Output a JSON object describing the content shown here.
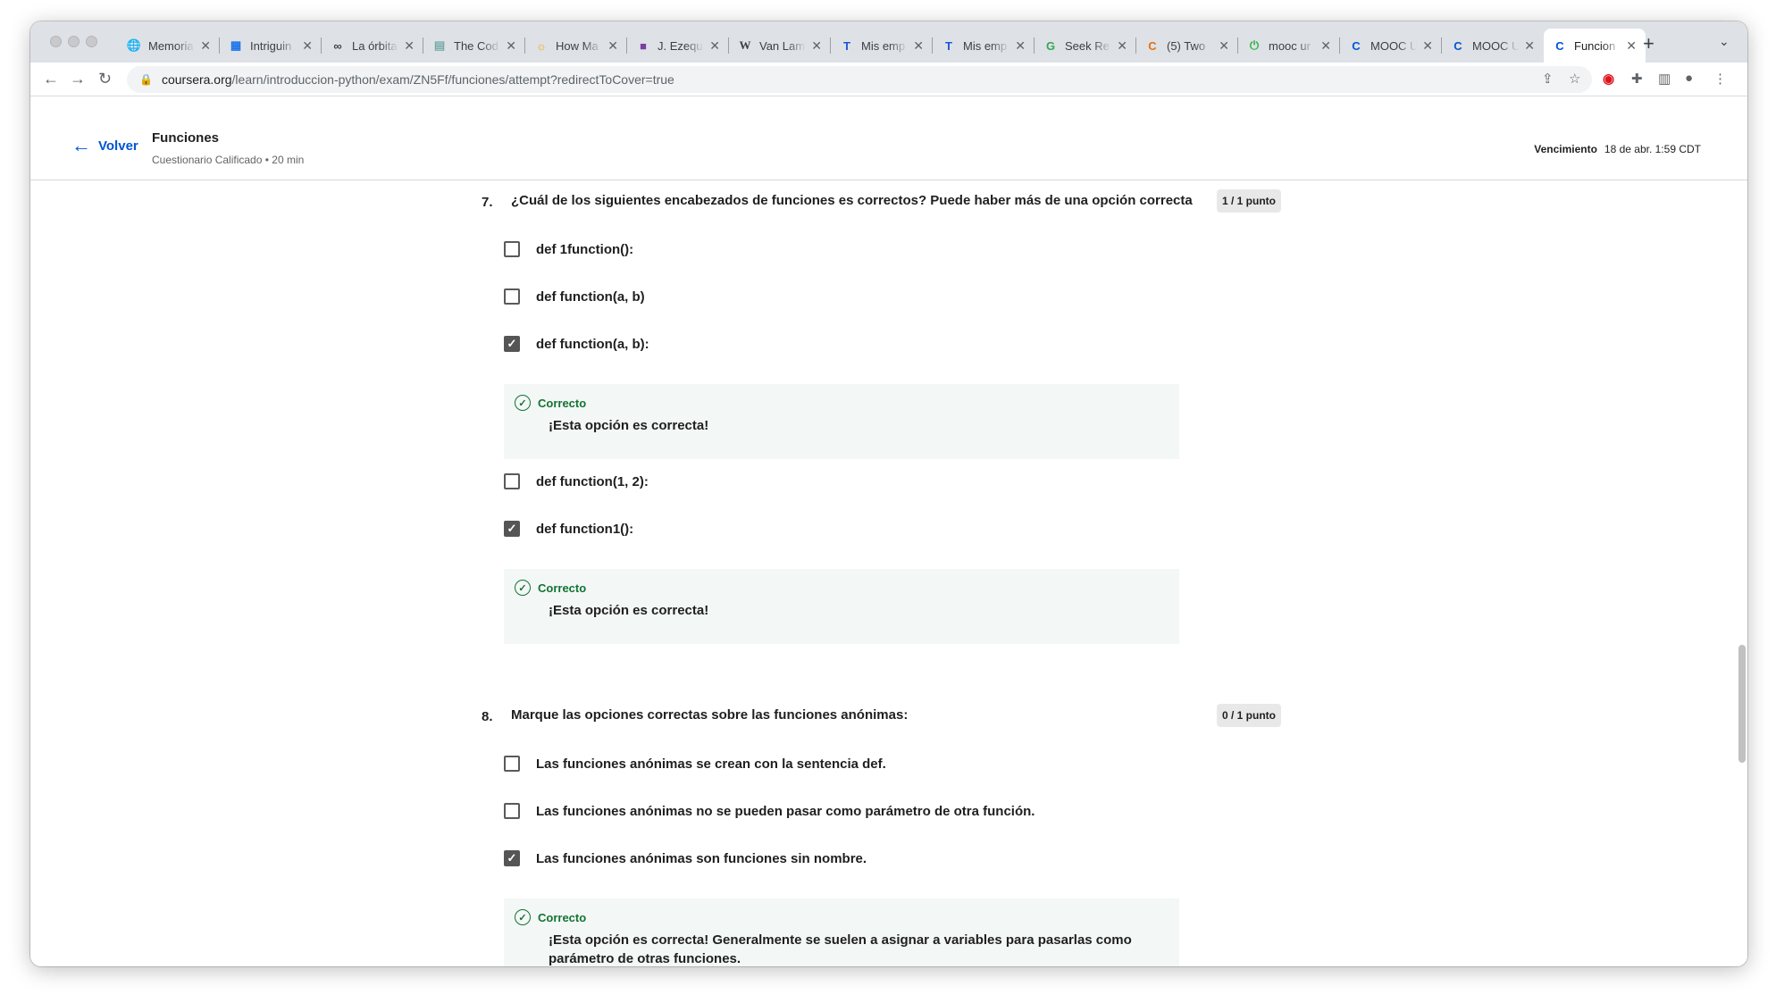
{
  "browser": {
    "tabs": [
      {
        "title": "Memoria",
        "icon": "globe-icon"
      },
      {
        "title": "Intriguin",
        "icon": "table-icon"
      },
      {
        "title": "La órbita",
        "icon": "infinity-icon"
      },
      {
        "title": "The Cod",
        "icon": "page-icon"
      },
      {
        "title": "How Ma",
        "icon": "sun-icon"
      },
      {
        "title": "J. Ezequ",
        "icon": "purple-square-icon"
      },
      {
        "title": "Van Lam",
        "icon": "wikipedia-icon"
      },
      {
        "title": "Mis emp",
        "icon": "blue-t-icon"
      },
      {
        "title": "Mis emp",
        "icon": "blue-t-icon"
      },
      {
        "title": "Seek Re",
        "icon": "google-icon"
      },
      {
        "title": "(5) Two",
        "icon": "colorful-c-icon"
      },
      {
        "title": "mooc ur",
        "icon": "green-power-icon"
      },
      {
        "title": "MOOC U",
        "icon": "coursera-icon"
      },
      {
        "title": "MOOC U",
        "icon": "coursera-icon"
      },
      {
        "title": "Funcion",
        "icon": "coursera-icon",
        "active": true
      }
    ],
    "url_host": "coursera.org",
    "url_path": "/learn/introduccion-python/exam/ZN5Ff/funciones/attempt?redirectToCover=true"
  },
  "header": {
    "back_label": "Volver",
    "title": "Funciones",
    "subtitle": "Cuestionario Calificado • 20 min",
    "due_label": "Vencimiento",
    "due_value": "18 de abr. 1:59 CDT"
  },
  "questions": [
    {
      "number": "7.",
      "text": "¿Cuál de los siguientes encabezados de funciones es correctos? Puede haber más de una opción correcta",
      "score": "1 / 1 punto",
      "options": [
        {
          "label": "def 1function():",
          "checked": false
        },
        {
          "label": "def function(a, b)",
          "checked": false
        },
        {
          "label": "def function(a, b):",
          "checked": true,
          "feedback_title": "Correcto",
          "feedback": "¡Esta opción es correcta!"
        },
        {
          "label": "def function(1, 2):",
          "checked": false
        },
        {
          "label": "def function1():",
          "checked": true,
          "feedback_title": "Correcto",
          "feedback": "¡Esta opción es correcta!"
        }
      ]
    },
    {
      "number": "8.",
      "text": "Marque las opciones correctas sobre las funciones anónimas:",
      "score": "0 / 1 punto",
      "options": [
        {
          "label": "Las funciones anónimas se crean con la sentencia def.",
          "checked": false
        },
        {
          "label": "Las funciones anónimas no se pueden pasar como parámetro de otra función.",
          "checked": false
        },
        {
          "label": "Las funciones anónimas son funciones sin nombre.",
          "checked": true,
          "feedback_title": "Correcto",
          "feedback": "¡Esta opción es correcta! Generalmente se suelen a asignar a variables para pasarlas como parámetro de otras funciones."
        }
      ]
    }
  ],
  "colors": {
    "accent": "#0056d2",
    "correct": "#137333",
    "feedback_bg": "#f3f7f6"
  }
}
